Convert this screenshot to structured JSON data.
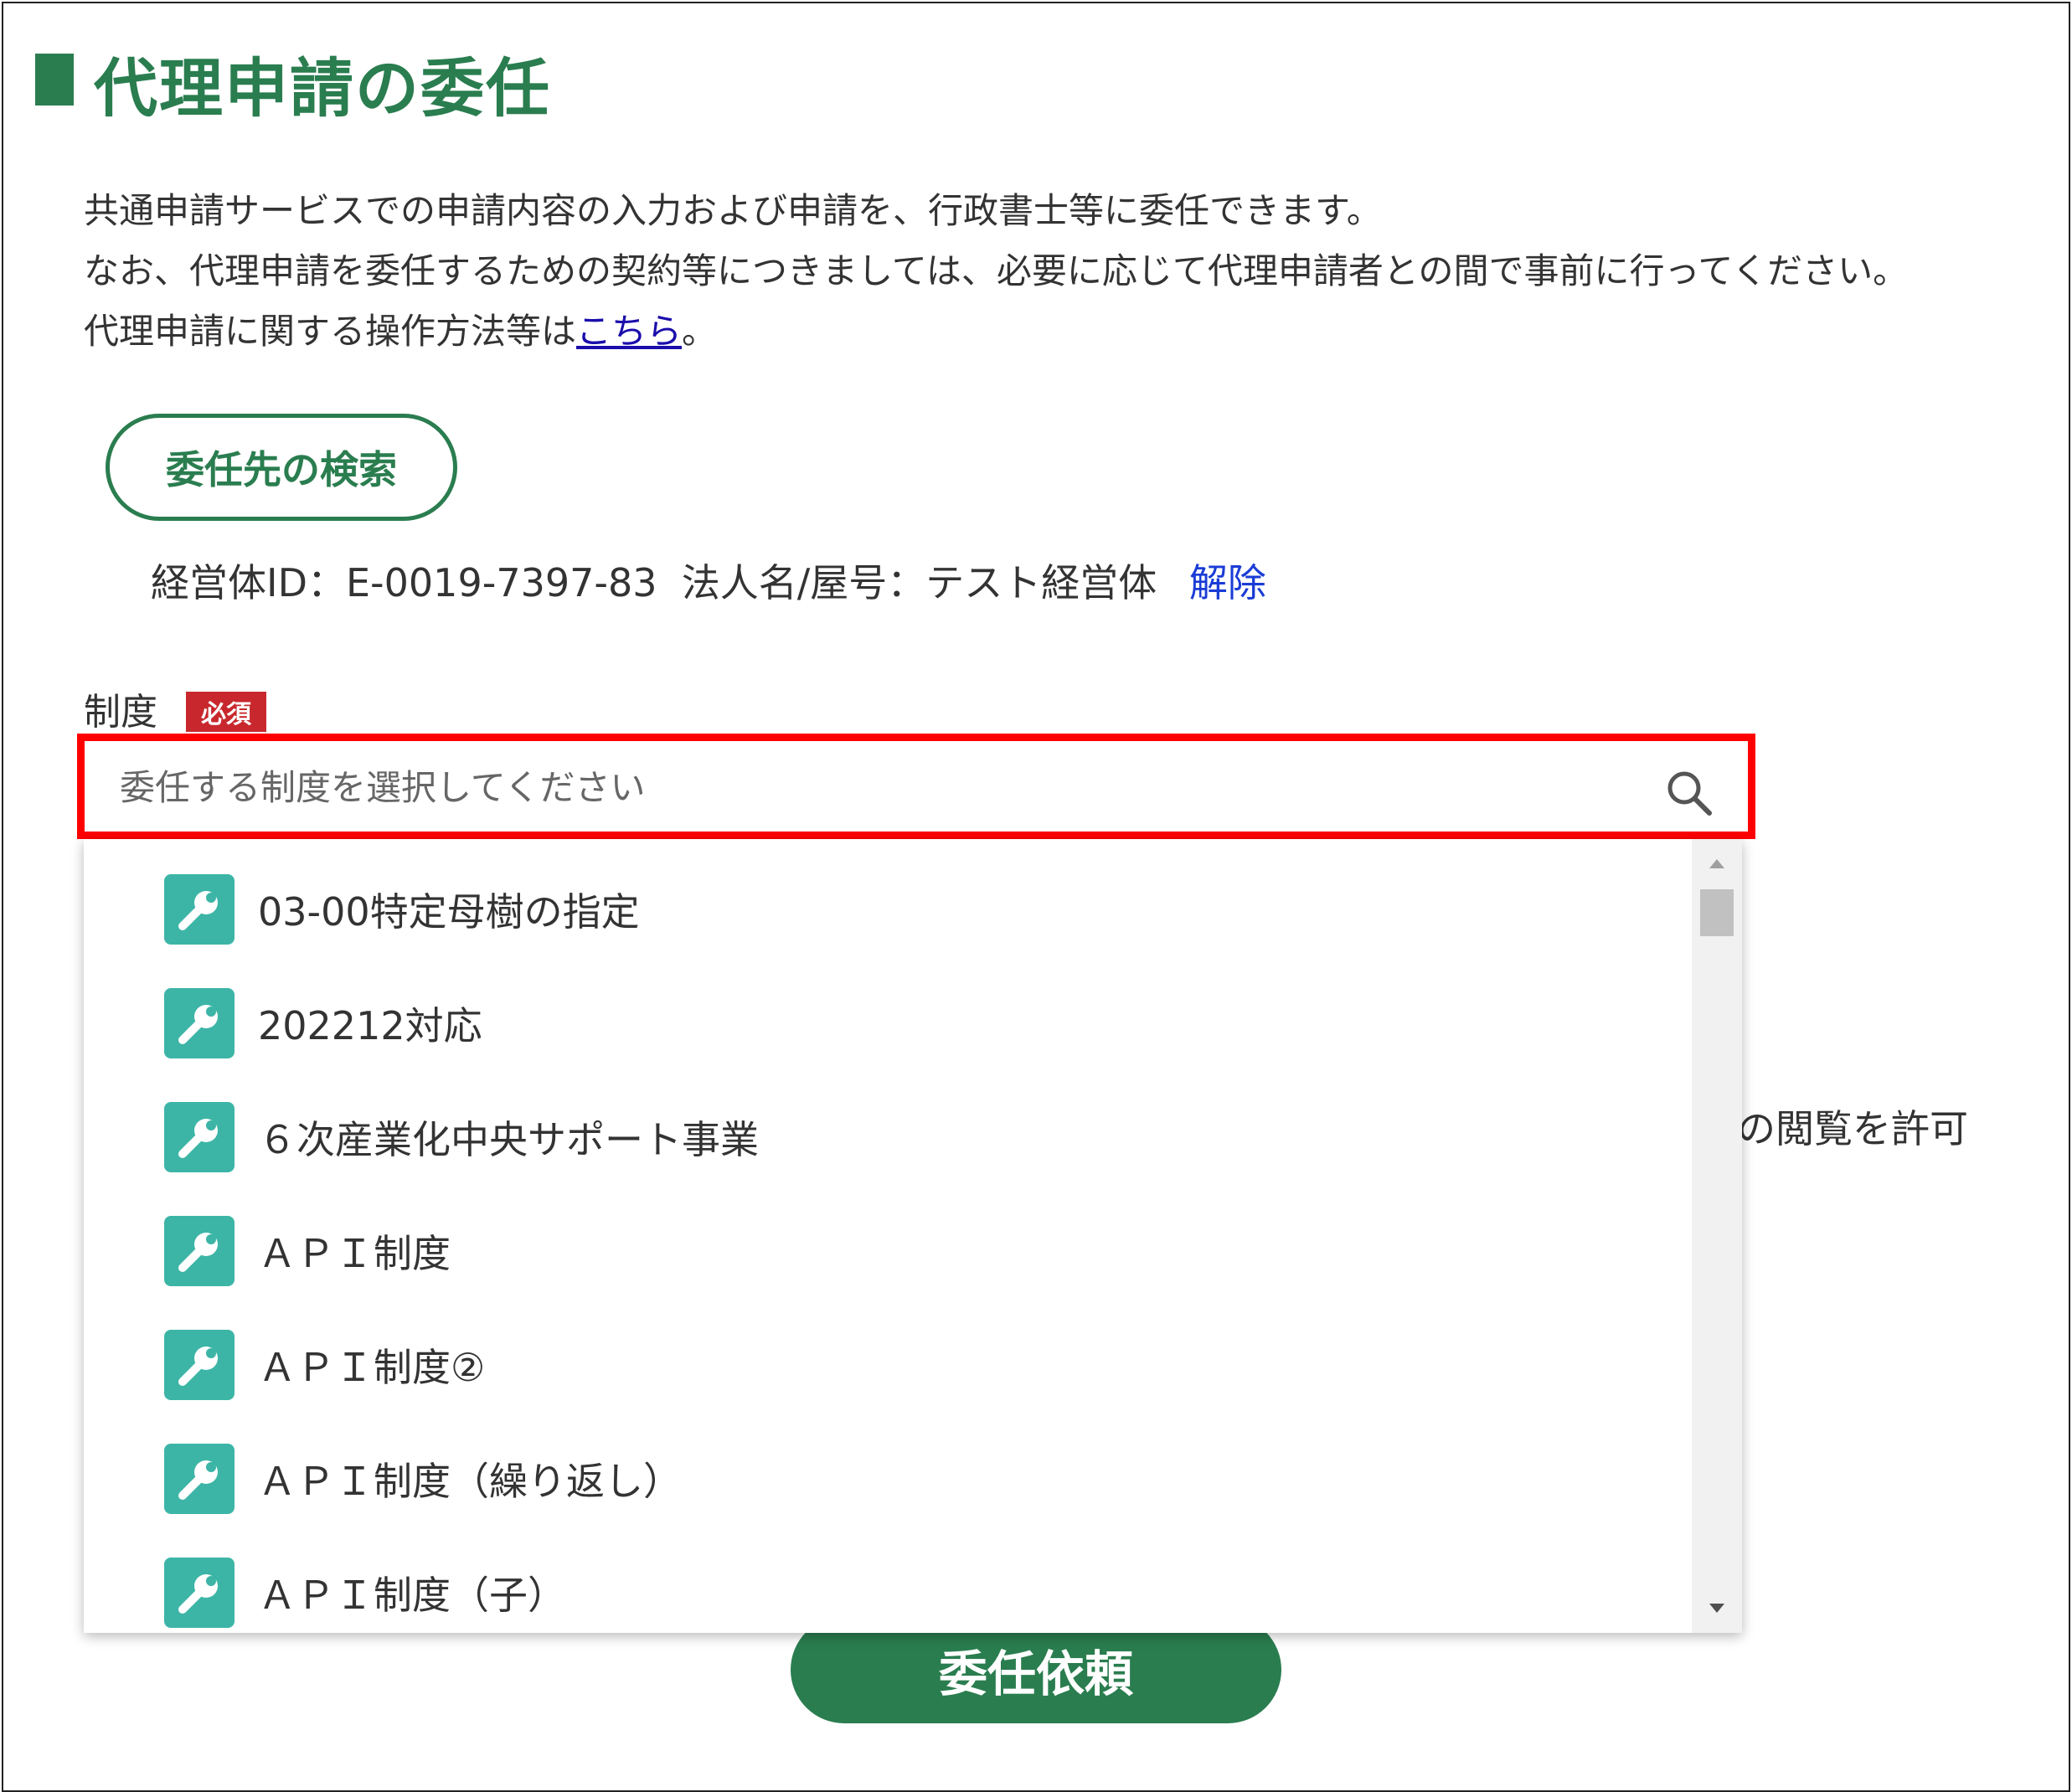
{
  "page": {
    "title": "代理申請の委任",
    "description": [
      "共通申請サービスでの申請内容の入力および申請を、行政書士等に委任できます。",
      "なお、代理申請を委任するための契約等につきましては、必要に応じて代理申請者との間で事前に行ってください。"
    ],
    "help_line_prefix": "代理申請に関する操作方法等は",
    "help_link": "こちら",
    "help_line_suffix": "。"
  },
  "delegate": {
    "search_button": "委任先の検索",
    "selected_info": "経営体ID：E-0019-7397-83  法人名/屋号：テスト経営体",
    "release_link": "解除"
  },
  "form": {
    "seido_label": "制度",
    "required_badge": "必須",
    "seido_placeholder": "委任する制度を選択してください",
    "behind_text": "の閲覧を許可",
    "submit_button": "委任依頼"
  },
  "dropdown": {
    "items": [
      {
        "label": "03-00特定母樹の指定",
        "icon": "wrench-icon"
      },
      {
        "label": "202212対応",
        "icon": "wrench-icon"
      },
      {
        "label": "６次産業化中央サポート事業",
        "icon": "wrench-icon"
      },
      {
        "label": "ＡＰＩ制度",
        "icon": "wrench-icon"
      },
      {
        "label": "ＡＰＩ制度②",
        "icon": "wrench-icon"
      },
      {
        "label": "ＡＰＩ制度（繰り返し）",
        "icon": "wrench-icon"
      },
      {
        "label": "ＡＰＩ制度（子）",
        "icon": "wrench-icon"
      }
    ]
  },
  "colors": {
    "brand_green": "#2a7d4f",
    "icon_teal": "#3cb5a6",
    "highlight_red": "#ff0000",
    "required_red": "#c8282d",
    "link_blue": "#1a0dab"
  }
}
